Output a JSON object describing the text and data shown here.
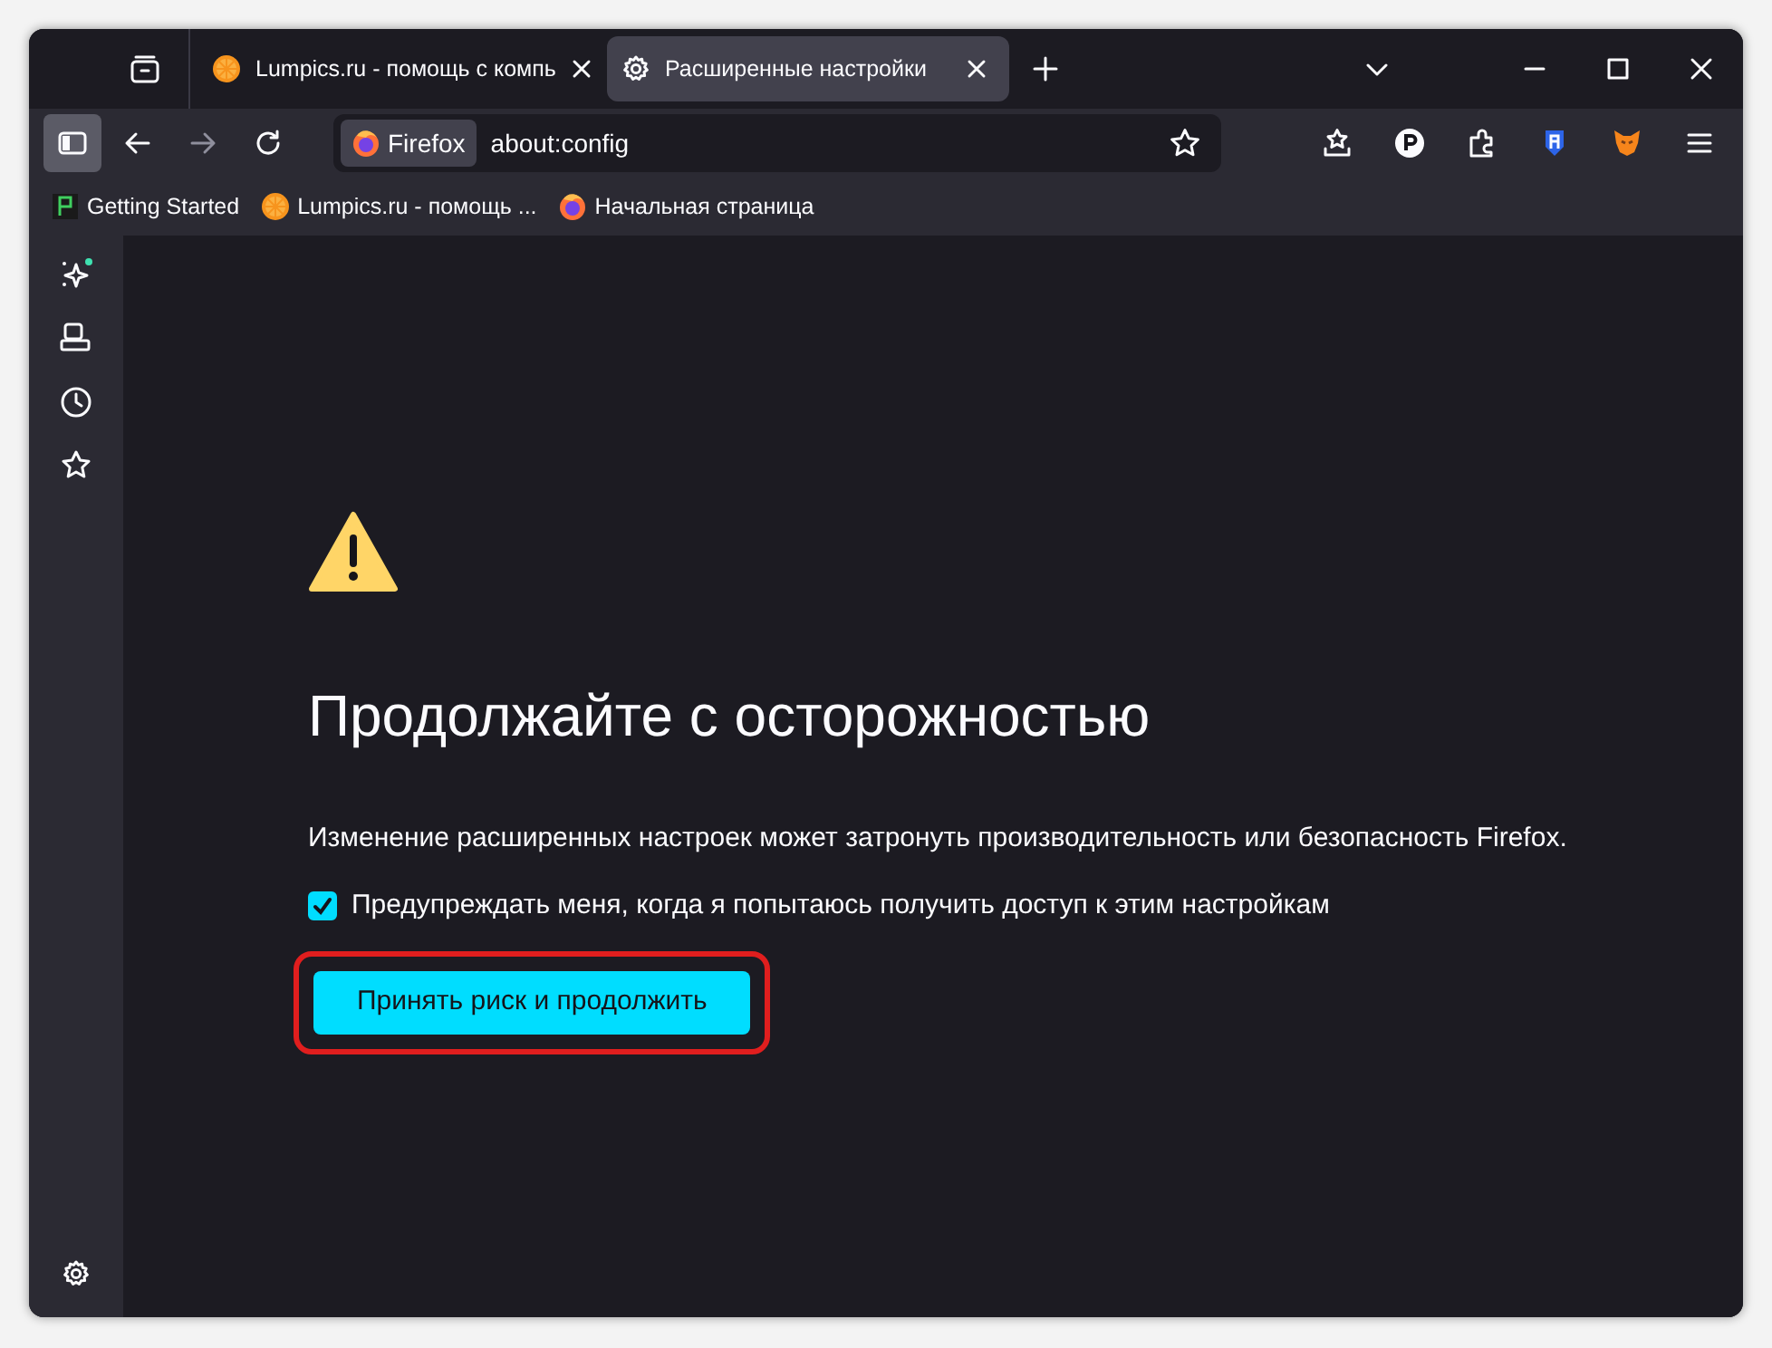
{
  "tabs": [
    {
      "label": "Lumpics.ru - помощь с компь",
      "kind": "site",
      "selected": false
    },
    {
      "label": "Расширенные настройки",
      "kind": "settings",
      "selected": true
    }
  ],
  "address": {
    "identity": "Firefox",
    "url": "about:config"
  },
  "bookmarks": [
    {
      "label": "Getting Started",
      "kind": "start"
    },
    {
      "label": "Lumpics.ru - помощь ...",
      "kind": "site"
    },
    {
      "label": "Начальная страница",
      "kind": "firefox"
    }
  ],
  "warning": {
    "title": "Продолжайте с осторожностью",
    "text": "Изменение расширенных настроек может затронуть производительность или безопасность Firefox.",
    "checkbox": {
      "label": "Предупреждать меня, когда я попытаюсь получить доступ к этим настройкам",
      "checked": true
    },
    "button": "Принять риск и продолжить"
  }
}
